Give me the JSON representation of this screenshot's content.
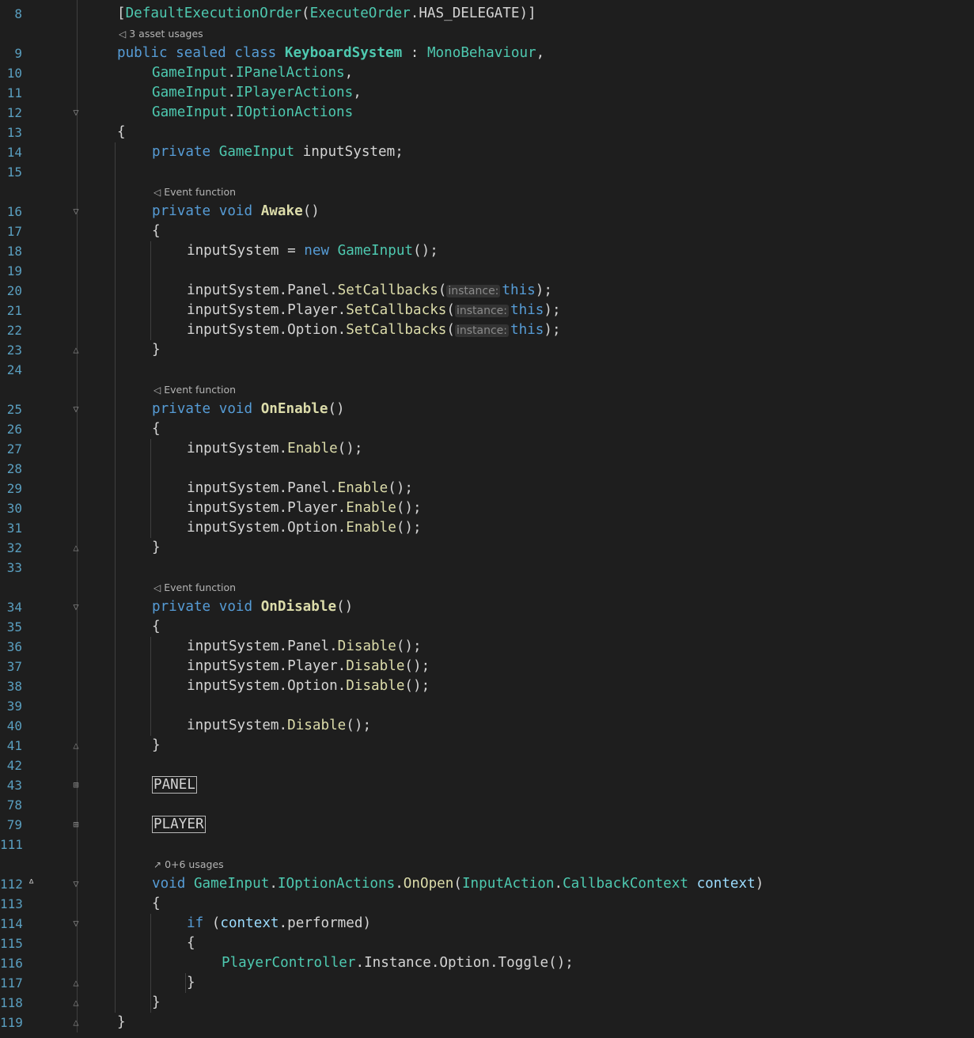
{
  "editor": {
    "lines": [
      {
        "type": "code",
        "n": "8",
        "ind": 0,
        "t": [
          [
            "[",
            ""
          ],
          [
            "DefaultExecutionOrder",
            "ty"
          ],
          [
            "(",
            ""
          ],
          [
            "ExecuteOrder",
            "ty"
          ],
          [
            ".HAS_DELEGATE)]",
            ""
          ]
        ]
      },
      {
        "type": "hint",
        "icon": "unity-icon",
        "text": "3 asset usages",
        "ind": 0
      },
      {
        "type": "code",
        "n": "9",
        "ind": 0,
        "t": [
          [
            "public",
            "kw"
          ],
          [
            " ",
            ""
          ],
          [
            "sealed",
            "kw"
          ],
          [
            " ",
            ""
          ],
          [
            "class",
            "kw"
          ],
          [
            " ",
            ""
          ],
          [
            "KeyboardSystem",
            "cls"
          ],
          [
            " : ",
            ""
          ],
          [
            "MonoBehaviour",
            "ty"
          ],
          [
            ",",
            ""
          ]
        ]
      },
      {
        "type": "code",
        "n": "10",
        "ind": 1,
        "t": [
          [
            "GameInput",
            "ty"
          ],
          [
            ".",
            ""
          ],
          [
            "IPanelActions",
            "ty"
          ],
          [
            ",",
            ""
          ]
        ]
      },
      {
        "type": "code",
        "n": "11",
        "ind": 1,
        "t": [
          [
            "GameInput",
            "ty"
          ],
          [
            ".",
            ""
          ],
          [
            "IPlayerActions",
            "ty"
          ],
          [
            ",",
            ""
          ]
        ]
      },
      {
        "type": "code",
        "n": "12",
        "ind": 1,
        "fold": "open",
        "t": [
          [
            "GameInput",
            "ty"
          ],
          [
            ".",
            ""
          ],
          [
            "IOptionActions",
            "ty"
          ]
        ]
      },
      {
        "type": "code",
        "n": "13",
        "ind": 0,
        "t": [
          [
            "{",
            ""
          ]
        ]
      },
      {
        "type": "code",
        "n": "14",
        "ind": 1,
        "t": [
          [
            "private",
            "kw"
          ],
          [
            " ",
            ""
          ],
          [
            "GameInput",
            "ty"
          ],
          [
            " inputSystem;",
            ""
          ]
        ]
      },
      {
        "type": "code",
        "n": "15",
        "ind": 0,
        "t": []
      },
      {
        "type": "hint",
        "icon": "unity-icon",
        "text": "Event function",
        "ind": 1
      },
      {
        "type": "code",
        "n": "16",
        "ind": 1,
        "fold": "open",
        "t": [
          [
            "private",
            "kw"
          ],
          [
            " ",
            ""
          ],
          [
            "void",
            "kw"
          ],
          [
            " ",
            ""
          ],
          [
            "Awake",
            "fn"
          ],
          [
            "()",
            ""
          ]
        ]
      },
      {
        "type": "code",
        "n": "17",
        "ind": 1,
        "t": [
          [
            "{",
            ""
          ]
        ]
      },
      {
        "type": "code",
        "n": "18",
        "ind": 2,
        "t": [
          [
            "inputSystem = ",
            ""
          ],
          [
            "new",
            "kw"
          ],
          [
            " ",
            ""
          ],
          [
            "GameInput",
            "ty"
          ],
          [
            "();",
            ""
          ]
        ]
      },
      {
        "type": "code",
        "n": "19",
        "ind": 0,
        "t": []
      },
      {
        "type": "code",
        "n": "20",
        "ind": 2,
        "t": [
          [
            "inputSystem.Panel.",
            ""
          ],
          [
            "SetCallbacks",
            "mth"
          ],
          [
            "(",
            ""
          ],
          [
            "instance:",
            "inlay"
          ],
          [
            "this",
            "kw"
          ],
          [
            ");",
            ""
          ]
        ]
      },
      {
        "type": "code",
        "n": "21",
        "ind": 2,
        "t": [
          [
            "inputSystem.Player.",
            ""
          ],
          [
            "SetCallbacks",
            "mth"
          ],
          [
            "(",
            ""
          ],
          [
            "instance:",
            "inlay"
          ],
          [
            "this",
            "kw"
          ],
          [
            ");",
            ""
          ]
        ]
      },
      {
        "type": "code",
        "n": "22",
        "ind": 2,
        "t": [
          [
            "inputSystem.Option.",
            ""
          ],
          [
            "SetCallbacks",
            "mth"
          ],
          [
            "(",
            ""
          ],
          [
            "instance:",
            "inlay"
          ],
          [
            "this",
            "kw"
          ],
          [
            ");",
            ""
          ]
        ]
      },
      {
        "type": "code",
        "n": "23",
        "ind": 1,
        "fold": "close",
        "t": [
          [
            "}",
            ""
          ]
        ]
      },
      {
        "type": "code",
        "n": "24",
        "ind": 0,
        "t": []
      },
      {
        "type": "hint",
        "icon": "unity-icon",
        "text": "Event function",
        "ind": 1
      },
      {
        "type": "code",
        "n": "25",
        "ind": 1,
        "fold": "open",
        "t": [
          [
            "private",
            "kw"
          ],
          [
            " ",
            ""
          ],
          [
            "void",
            "kw"
          ],
          [
            " ",
            ""
          ],
          [
            "OnEnable",
            "fn"
          ],
          [
            "()",
            ""
          ]
        ]
      },
      {
        "type": "code",
        "n": "26",
        "ind": 1,
        "t": [
          [
            "{",
            ""
          ]
        ]
      },
      {
        "type": "code",
        "n": "27",
        "ind": 2,
        "t": [
          [
            "inputSystem.",
            ""
          ],
          [
            "Enable",
            "mth"
          ],
          [
            "();",
            ""
          ]
        ]
      },
      {
        "type": "code",
        "n": "28",
        "ind": 0,
        "t": []
      },
      {
        "type": "code",
        "n": "29",
        "ind": 2,
        "t": [
          [
            "inputSystem.Panel.",
            ""
          ],
          [
            "Enable",
            "mth"
          ],
          [
            "();",
            ""
          ]
        ]
      },
      {
        "type": "code",
        "n": "30",
        "ind": 2,
        "t": [
          [
            "inputSystem.Player.",
            ""
          ],
          [
            "Enable",
            "mth"
          ],
          [
            "();",
            ""
          ]
        ]
      },
      {
        "type": "code",
        "n": "31",
        "ind": 2,
        "t": [
          [
            "inputSystem.Option.",
            ""
          ],
          [
            "Enable",
            "mth"
          ],
          [
            "();",
            ""
          ]
        ]
      },
      {
        "type": "code",
        "n": "32",
        "ind": 1,
        "fold": "close",
        "t": [
          [
            "}",
            ""
          ]
        ]
      },
      {
        "type": "code",
        "n": "33",
        "ind": 0,
        "t": []
      },
      {
        "type": "hint",
        "icon": "unity-icon",
        "text": "Event function",
        "ind": 1
      },
      {
        "type": "code",
        "n": "34",
        "ind": 1,
        "fold": "open",
        "t": [
          [
            "private",
            "kw"
          ],
          [
            " ",
            ""
          ],
          [
            "void",
            "kw"
          ],
          [
            " ",
            ""
          ],
          [
            "OnDisable",
            "fn"
          ],
          [
            "()",
            ""
          ]
        ]
      },
      {
        "type": "code",
        "n": "35",
        "ind": 1,
        "t": [
          [
            "{",
            ""
          ]
        ]
      },
      {
        "type": "code",
        "n": "36",
        "ind": 2,
        "t": [
          [
            "inputSystem.Panel.",
            ""
          ],
          [
            "Disable",
            "mth"
          ],
          [
            "();",
            ""
          ]
        ]
      },
      {
        "type": "code",
        "n": "37",
        "ind": 2,
        "t": [
          [
            "inputSystem.Player.",
            ""
          ],
          [
            "Disable",
            "mth"
          ],
          [
            "();",
            ""
          ]
        ]
      },
      {
        "type": "code",
        "n": "38",
        "ind": 2,
        "t": [
          [
            "inputSystem.Option.",
            ""
          ],
          [
            "Disable",
            "mth"
          ],
          [
            "();",
            ""
          ]
        ]
      },
      {
        "type": "code",
        "n": "39",
        "ind": 0,
        "t": []
      },
      {
        "type": "code",
        "n": "40",
        "ind": 2,
        "t": [
          [
            "inputSystem.",
            ""
          ],
          [
            "Disable",
            "mth"
          ],
          [
            "();",
            ""
          ]
        ]
      },
      {
        "type": "code",
        "n": "41",
        "ind": 1,
        "fold": "close",
        "t": [
          [
            "}",
            ""
          ]
        ]
      },
      {
        "type": "code",
        "n": "42",
        "ind": 0,
        "t": []
      },
      {
        "type": "code",
        "n": "43",
        "ind": 1,
        "fold": "collapsed",
        "t": [
          [
            "PANEL",
            "region"
          ]
        ]
      },
      {
        "type": "code",
        "n": "78",
        "ind": 0,
        "t": []
      },
      {
        "type": "code",
        "n": "79",
        "ind": 1,
        "fold": "collapsed",
        "t": [
          [
            "PLAYER",
            "region"
          ]
        ]
      },
      {
        "type": "code",
        "n": "111",
        "ind": 0,
        "t": []
      },
      {
        "type": "hint",
        "icon": "usages-icon",
        "text": "0+6 usages",
        "ind": 1
      },
      {
        "type": "code",
        "n": "112",
        "ind": 1,
        "fold": "open",
        "mark": "implements-icon",
        "t": [
          [
            "void",
            "kw"
          ],
          [
            " ",
            ""
          ],
          [
            "GameInput",
            "ty"
          ],
          [
            ".",
            ""
          ],
          [
            "IOptionActions",
            "ty"
          ],
          [
            ".",
            ""
          ],
          [
            "OnOpen",
            "mth"
          ],
          [
            "(",
            ""
          ],
          [
            "InputAction",
            "ty"
          ],
          [
            ".",
            ""
          ],
          [
            "CallbackContext",
            "ty"
          ],
          [
            " ",
            ""
          ],
          [
            "context",
            "prm"
          ],
          [
            ")",
            ""
          ]
        ]
      },
      {
        "type": "code",
        "n": "113",
        "ind": 1,
        "t": [
          [
            "{",
            ""
          ]
        ]
      },
      {
        "type": "code",
        "n": "114",
        "ind": 2,
        "fold": "open",
        "t": [
          [
            "if",
            "kw"
          ],
          [
            " (",
            ""
          ],
          [
            "context",
            "prm"
          ],
          [
            ".performed)",
            ""
          ]
        ]
      },
      {
        "type": "code",
        "n": "115",
        "ind": 2,
        "t": [
          [
            "{",
            ""
          ]
        ]
      },
      {
        "type": "code",
        "n": "116",
        "ind": 3,
        "t": [
          [
            "PlayerController",
            "ty"
          ],
          [
            ".Instance.Option.Toggle();",
            ""
          ]
        ]
      },
      {
        "type": "code",
        "n": "117",
        "ind": 2,
        "fold": "close",
        "t": [
          [
            "}",
            ""
          ]
        ]
      },
      {
        "type": "code",
        "n": "118",
        "ind": 1,
        "fold": "close",
        "t": [
          [
            "}",
            ""
          ]
        ]
      },
      {
        "type": "code",
        "n": "119",
        "ind": 0,
        "fold": "close",
        "t": [
          [
            "}",
            ""
          ]
        ]
      }
    ],
    "icons": {
      "unity-icon": "◁",
      "usages-icon": "↗",
      "implements-icon": "ᐞ",
      "fold-open": "▽",
      "fold-close": "△",
      "fold-collapsed": "⊞"
    },
    "colors": {
      "background": "#1e1e1e",
      "keyword": "#569cd6",
      "type": "#4ec9b0",
      "method": "#dcdcaa",
      "parameter": "#9cdcfe",
      "line_number": "#5a9fc0"
    }
  }
}
